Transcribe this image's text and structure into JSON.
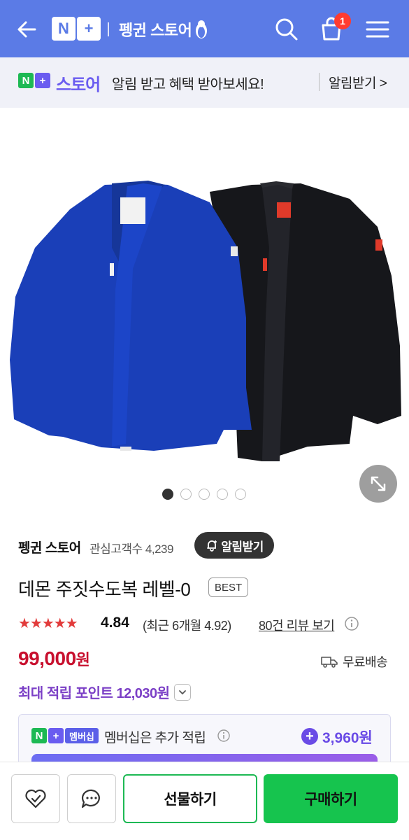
{
  "header": {
    "logo_n": "N",
    "logo_plus": "+",
    "store_name": "펭귄 스토어",
    "cart_count": "1",
    "brand_color": "#5b7be6"
  },
  "promo": {
    "logo_n": "N",
    "logo_plus": "+",
    "store_label": "스토어",
    "message": "알림 받고 혜택 받아보세요!",
    "cta": "알림받기 >"
  },
  "gallery": {
    "total_images": 5,
    "active_index": 0
  },
  "seller": {
    "name": "펭귄 스토어",
    "followers": "관심고객수 4,239",
    "notify_label": "알림받기"
  },
  "product": {
    "title": "데몬 주짓수도복 레벨-0",
    "badge": "BEST",
    "stars": "★★★★★",
    "rating": "4.84",
    "recent_rating": "(최근 6개월 4.92)",
    "reviews_link": "80건 리뷰 보기",
    "price_number": "99,000",
    "price_unit": "원",
    "shipping": "무료배송",
    "points": "최대 적립 포인트 12,030원"
  },
  "membership": {
    "logo_n": "N",
    "logo_plus": "+",
    "tag": "멤버십",
    "text": "멤버십은 추가 적립",
    "plus": "+",
    "amount": "3,960원"
  },
  "bottom": {
    "gift_label": "선물하기",
    "buy_label": "구매하기"
  },
  "colors": {
    "price": "#c8102e",
    "points": "#7b3fc6",
    "buy": "#16c44e",
    "star": "#e23b3b"
  }
}
